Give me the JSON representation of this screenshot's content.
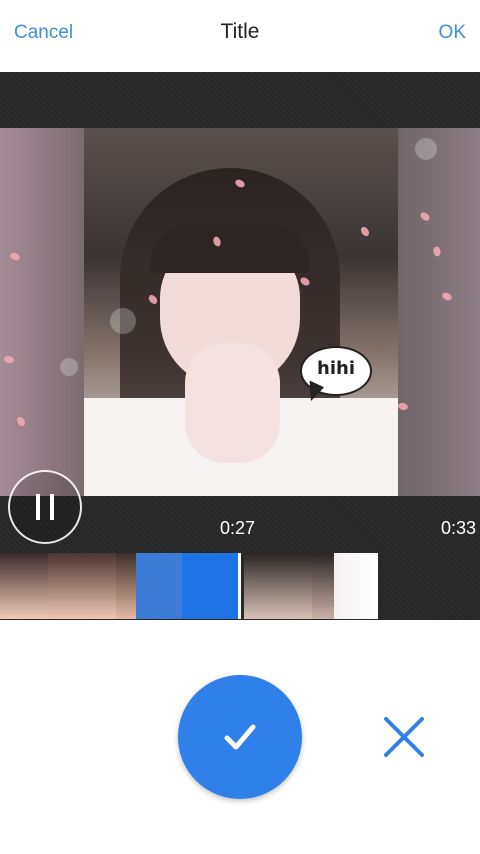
{
  "header": {
    "cancel_label": "Cancel",
    "title": "Title",
    "ok_label": "OK"
  },
  "preview": {
    "speech_bubble_text": "hihi"
  },
  "player": {
    "current_time": "0:27",
    "total_time": "0:33"
  },
  "colors": {
    "accent": "#2f80e8",
    "link": "#3d8fe0",
    "dark_bar": "#2a2a2a"
  },
  "icons": {
    "play_pause": "pause-icon",
    "confirm": "checkmark-icon",
    "discard": "close-icon"
  }
}
